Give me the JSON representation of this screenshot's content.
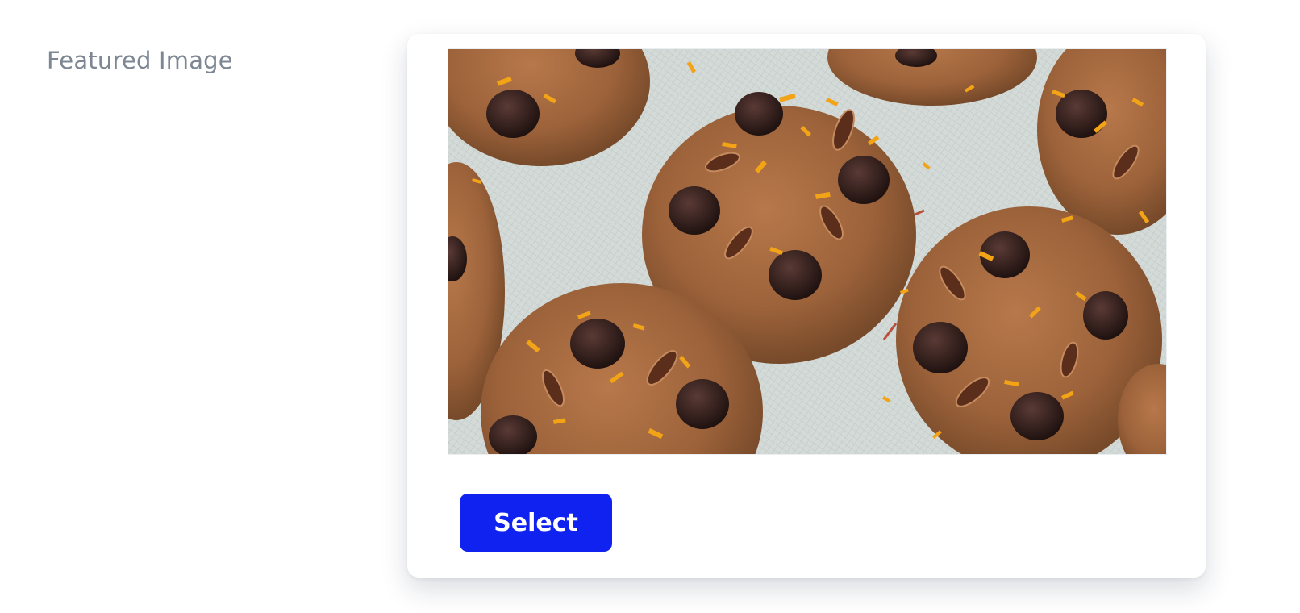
{
  "field": {
    "label": "Featured Image"
  },
  "image_preview": {
    "subject": "chocolate chip pecan cookies with orange zest on a baking mat",
    "icon": "image-preview"
  },
  "actions": {
    "select_label": "Select"
  },
  "colors": {
    "label_text": "#7d8793",
    "button_bg": "#0f22f0",
    "button_text": "#ffffff",
    "card_bg": "#ffffff"
  }
}
